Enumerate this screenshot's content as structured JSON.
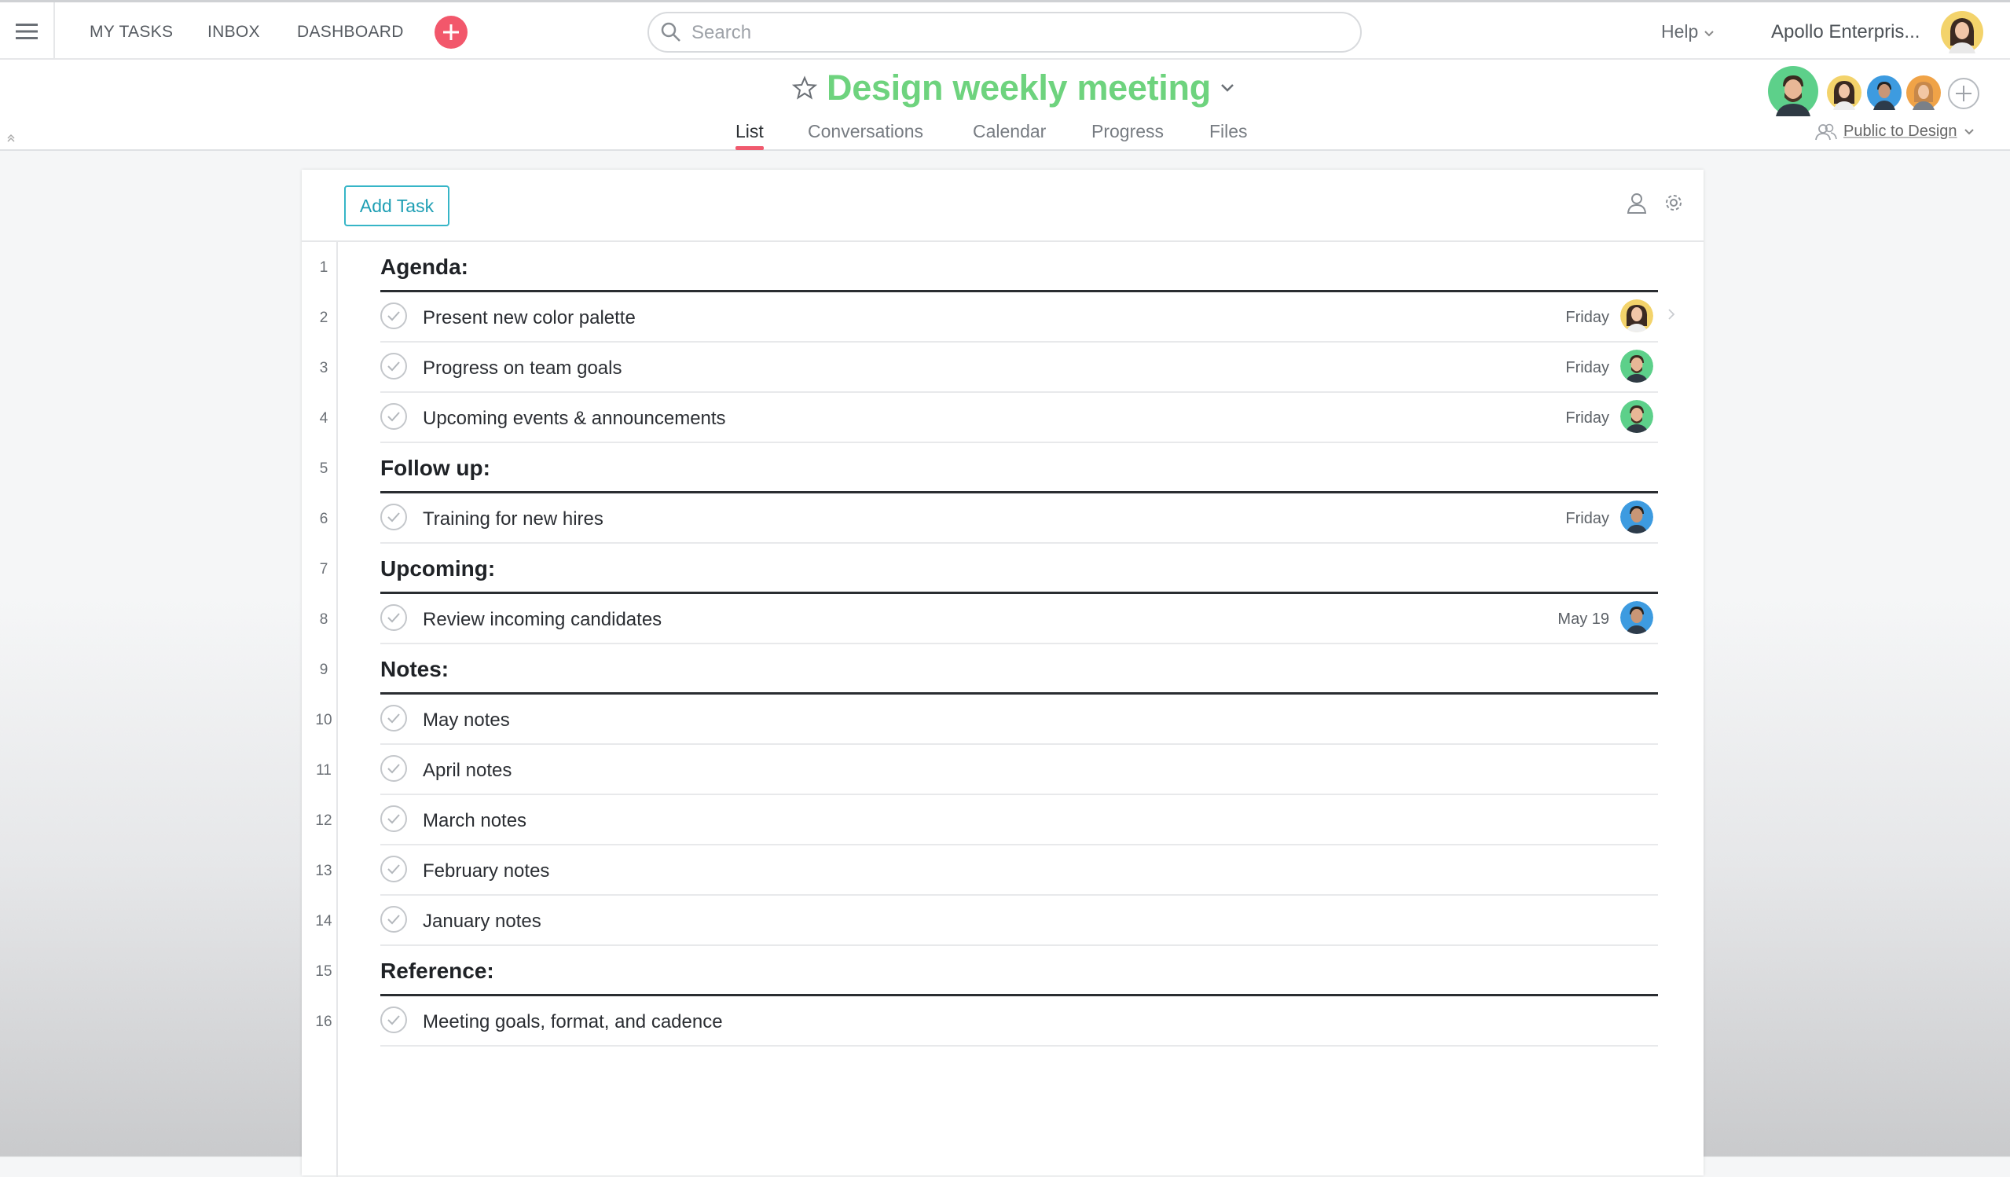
{
  "topnav": {
    "links": [
      "MY TASKS",
      "INBOX",
      "DASHBOARD"
    ],
    "search_placeholder": "Search",
    "help": "Help",
    "org": "Apollo Enterpris...",
    "accent": "#f2576b"
  },
  "project": {
    "title": "Design weekly meeting",
    "title_color": "#6ed37e",
    "tabs": [
      "List",
      "Conversations",
      "Calendar",
      "Progress",
      "Files"
    ],
    "active_tab": "List",
    "privacy": "Public to Design"
  },
  "toolbar": {
    "add_task": "Add Task"
  },
  "rows": [
    {
      "num": "1",
      "type": "section",
      "title": "Agenda:"
    },
    {
      "num": "2",
      "type": "task",
      "name": "Present new color palette",
      "due": "Friday",
      "assignee": "woman-dark-hair"
    },
    {
      "num": "3",
      "type": "task",
      "name": "Progress on team goals",
      "due": "Friday",
      "assignee": "man-beard-green"
    },
    {
      "num": "4",
      "type": "task",
      "name": "Upcoming events & announcements",
      "due": "Friday",
      "assignee": "man-beard-green"
    },
    {
      "num": "5",
      "type": "section",
      "title": "Follow up:"
    },
    {
      "num": "6",
      "type": "task",
      "name": "Training for new hires",
      "due": "Friday",
      "assignee": "man-blue"
    },
    {
      "num": "7",
      "type": "section",
      "title": "Upcoming:"
    },
    {
      "num": "8",
      "type": "task",
      "name": "Review incoming candidates",
      "due": "May 19",
      "assignee": "man-blue"
    },
    {
      "num": "9",
      "type": "section",
      "title": "Notes:"
    },
    {
      "num": "10",
      "type": "task",
      "name": "May notes",
      "due": "",
      "assignee": ""
    },
    {
      "num": "11",
      "type": "task",
      "name": "April notes",
      "due": "",
      "assignee": ""
    },
    {
      "num": "12",
      "type": "task",
      "name": "March notes",
      "due": "",
      "assignee": ""
    },
    {
      "num": "13",
      "type": "task",
      "name": "February notes",
      "due": "",
      "assignee": ""
    },
    {
      "num": "14",
      "type": "task",
      "name": "January notes",
      "due": "",
      "assignee": ""
    },
    {
      "num": "15",
      "type": "section",
      "title": "Reference:"
    },
    {
      "num": "16",
      "type": "task",
      "name": "Meeting goals, format, and cadence",
      "due": "",
      "assignee": ""
    }
  ]
}
